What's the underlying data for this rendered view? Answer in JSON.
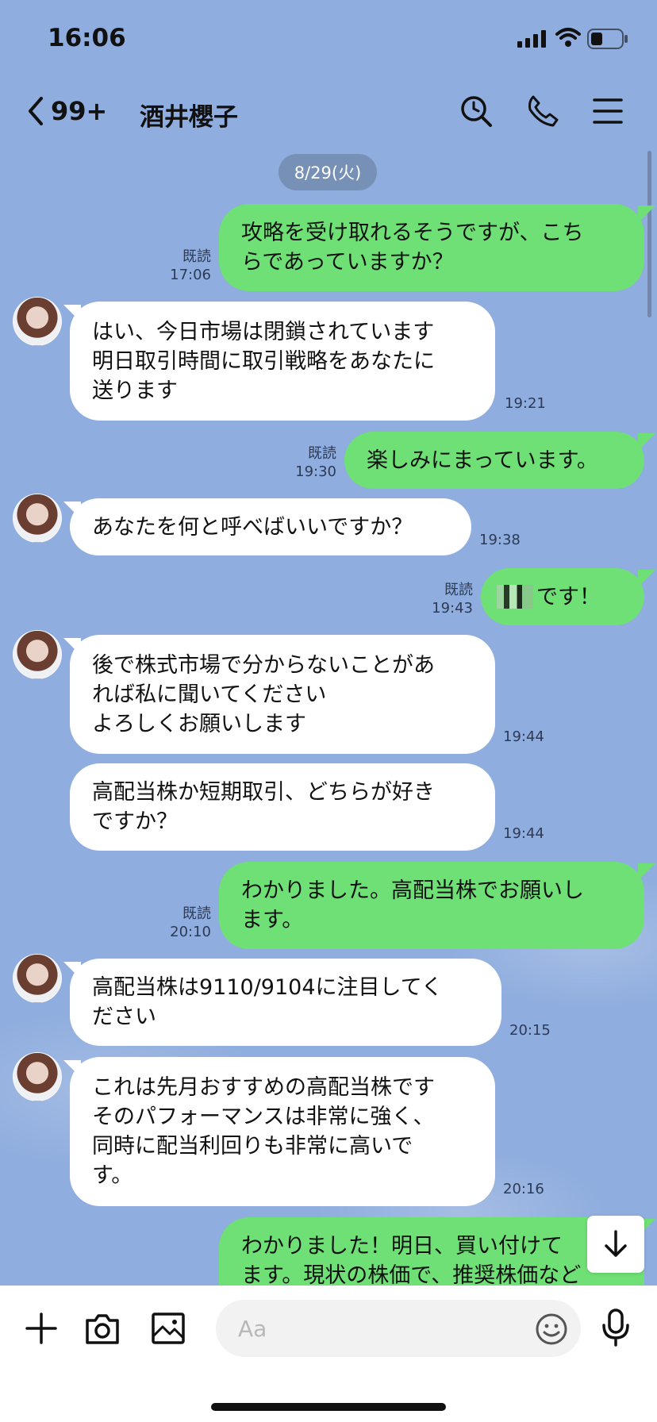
{
  "status_bar": {
    "time": "16:06"
  },
  "header": {
    "back_count": "99+",
    "title": "酒井櫻子"
  },
  "date_separator": "8/29(火)",
  "messages": [
    {
      "dir": "out",
      "text": "攻略を受け取れるそうですが、こち\nらであっていますか？",
      "read": "既読",
      "time": "17:06"
    },
    {
      "dir": "in",
      "text": "はい、今日市場は閉鎖されています\n明日取引時間に取引戦略をあなたに\n送ります",
      "time": "19:21"
    },
    {
      "dir": "out",
      "text": "楽しみにまっています。",
      "read": "既読",
      "time": "19:30"
    },
    {
      "dir": "in",
      "text": "あなたを何と呼べばいいですか？",
      "time": "19:38"
    },
    {
      "dir": "out",
      "text": "です！",
      "read": "既読",
      "time": "19:43",
      "redacted_prefix": true
    },
    {
      "dir": "in",
      "text": "後で株式市場で分からないことがあ\nれば私に聞いてください\nよろしくお願いします",
      "time": "19:44"
    },
    {
      "dir": "in",
      "text": "高配当株か短期取引、どちらが好き\nですか？",
      "time": "19:44"
    },
    {
      "dir": "out",
      "text": "わかりました。高配当株でお願いし\nます。",
      "read": "既読",
      "time": "20:10"
    },
    {
      "dir": "in",
      "text": "高配当株は9110/9104に注目してく\nださい",
      "time": "20:15"
    },
    {
      "dir": "in",
      "text": "これは先月おすすめの高配当株です\nそのパフォーマンスは非常に強く、\n同時に配当利回りも非常に高いで\nす。",
      "time": "20:16"
    },
    {
      "dir": "out",
      "text": "わかりました！明日、買い付けて\nます。現状の株価で、推奨株価など",
      "partial": true
    }
  ],
  "composer": {
    "placeholder": "Aa"
  },
  "colors": {
    "background": "#8fadde",
    "outgoing_bubble": "#6fe075",
    "incoming_bubble": "#ffffff"
  }
}
